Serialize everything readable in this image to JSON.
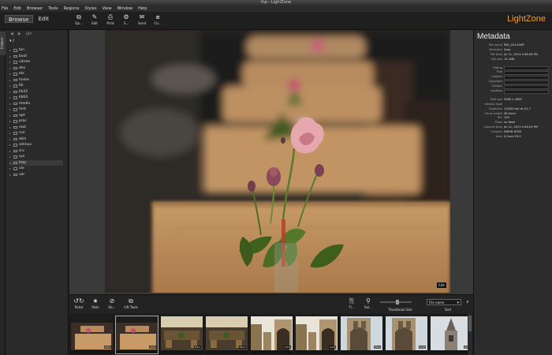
{
  "window": {
    "title": "fnp - LightZone"
  },
  "menu": [
    "File",
    "Edit",
    "Browser",
    "Tools",
    "Regions",
    "Styles",
    "View",
    "Window",
    "Help"
  ],
  "modes": {
    "browse": "Browse",
    "edit": "Edit"
  },
  "toolbar": {
    "buttons": [
      {
        "icon": "open-icon",
        "glyph": "⧉",
        "label": "Op..."
      },
      {
        "icon": "edit-icon",
        "glyph": "✎",
        "label": "Edit"
      },
      {
        "icon": "print-icon",
        "glyph": "⎙",
        "label": "Print"
      },
      {
        "icon": "styles-icon",
        "glyph": "⚙",
        "label": "S..."
      },
      {
        "icon": "send-icon",
        "glyph": "✉",
        "label": "Send"
      },
      {
        "icon": "convert-icon",
        "glyph": "⧈",
        "label": "Co..."
      }
    ]
  },
  "brand": "LightZone",
  "sidebar": {
    "tab": "Folders",
    "root": "/"
  },
  "folders": [
    "bin",
    "boot",
    "cdrom",
    "dev",
    "etc",
    "home",
    "lib",
    "lib32",
    "lib64",
    "media",
    "mnt",
    "opt",
    "proc",
    "root",
    "run",
    "sbin",
    "selinux",
    "srv",
    "sys",
    "tmp",
    "usr",
    "var"
  ],
  "selected_folder": "tmp",
  "preview": {
    "badge": "Edit"
  },
  "metadata": {
    "title": "Metadata",
    "file_rows": [
      {
        "k": "File name",
        "v": "IMG_0314.NEF"
      },
      {
        "k": "Directory",
        "v": "/tmp"
      },
      {
        "k": "File time",
        "v": "Jul 11, 2013 5:46:06 PM"
      },
      {
        "k": "File size",
        "v": "15.1MB"
      }
    ],
    "edit_rows": [
      "Rating",
      "Title",
      "Caption",
      "Copyright",
      "Creator",
      "Location"
    ],
    "exif_rows": [
      {
        "k": "Edit size",
        "v": "3984 x 2656"
      },
      {
        "k": "Version type",
        "v": ""
      },
      {
        "k": "Exposure",
        "v": "1/2000 sec at f/1.7"
      },
      {
        "k": "Focal length",
        "v": "58.0mm"
      },
      {
        "k": "ISO",
        "v": "100"
      },
      {
        "k": "Flash",
        "v": "no flash"
      },
      {
        "k": "Capture time",
        "v": "Jul 11, 2013 5:46:03 PM"
      },
      {
        "k": "Camera",
        "v": "NIKON D300"
      },
      {
        "k": "Lens",
        "v": "0.0mm F0.0"
      }
    ]
  },
  "browser_toolbar": {
    "left": [
      {
        "icon": "rotate-icon",
        "glyph": "↺↻",
        "label": "Rotat"
      },
      {
        "icon": "rate-icon",
        "glyph": "★",
        "label": "Rate"
      },
      {
        "icon": "delete-icon",
        "glyph": "⊘",
        "label": "De..."
      },
      {
        "icon": "lift-tools-icon",
        "glyph": "⧉",
        "label": "Lift Tools"
      }
    ],
    "right": [
      {
        "icon": "copy-icon",
        "glyph": "⎘",
        "label": "Ti..."
      },
      {
        "icon": "search-icon",
        "glyph": "⚲",
        "label": "Sel..."
      }
    ],
    "thumbnail_size_label": "Thumbnail Size",
    "sort_label": "Sort",
    "sort_value": "File name"
  },
  "filmstrip": [
    {
      "kind": "tables",
      "tag": "JPEG"
    },
    {
      "kind": "tables",
      "tag": "RAW"
    },
    {
      "kind": "lounge",
      "tag": "JPEG"
    },
    {
      "kind": "lounge",
      "tag": "RAW"
    },
    {
      "kind": "arch",
      "tag": "JPEG"
    },
    {
      "kind": "arch",
      "tag": "RAW"
    },
    {
      "kind": "tower",
      "tag": "JPEG"
    },
    {
      "kind": "tower",
      "tag": "RAW"
    },
    {
      "kind": "spire",
      "tag": "JPEG"
    }
  ]
}
